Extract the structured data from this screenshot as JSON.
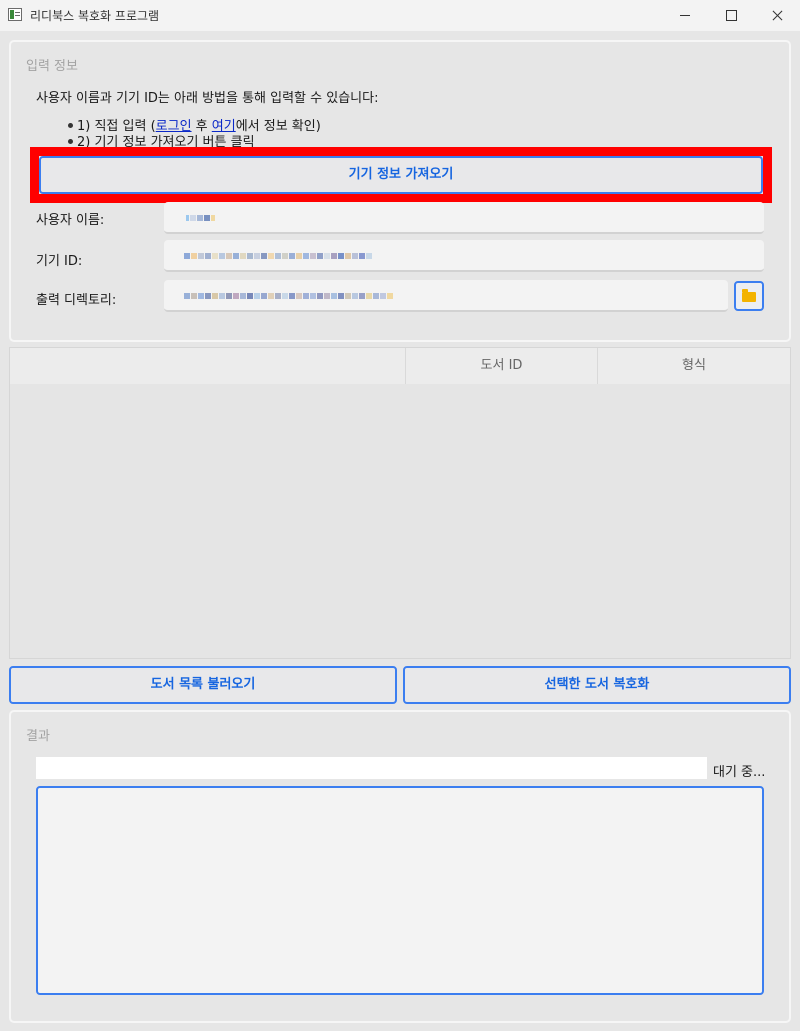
{
  "window": {
    "title": "리디북스 복호화 프로그램"
  },
  "input_group": {
    "title": "입력 정보",
    "instruction": "사용자 이름과 기기 ID는 아래 방법을 통해 입력할 수 있습니다:",
    "step1_prefix": "1) 직접 입력 (",
    "step1_login_link": "로그인",
    "step1_mid": " 후 ",
    "step1_here_link": "여기",
    "step1_suffix": "에서 정보 확인)",
    "step2": "2) 기기 정보 가져오기 버튼 클릭",
    "fetch_button": "기기 정보 가져오기",
    "username_label": "사용자 이름:",
    "device_id_label": "기기 ID:",
    "output_dir_label": "출력 디렉토리:",
    "folder_icon": "folder-icon"
  },
  "table": {
    "columns": [
      "",
      "도서 ID",
      "형식"
    ],
    "rows": []
  },
  "actions": {
    "load_books_button": "도서 목록 불러오기",
    "decrypt_selected_button": "선택한 도서 복호화"
  },
  "result_group": {
    "title": "결과",
    "status": "대기 중..."
  },
  "colors": {
    "accent": "#3b7ef0",
    "button_text": "#1665e0",
    "highlight": "#ff0000",
    "link": "#0a28c8",
    "folder": "#f3b300"
  }
}
